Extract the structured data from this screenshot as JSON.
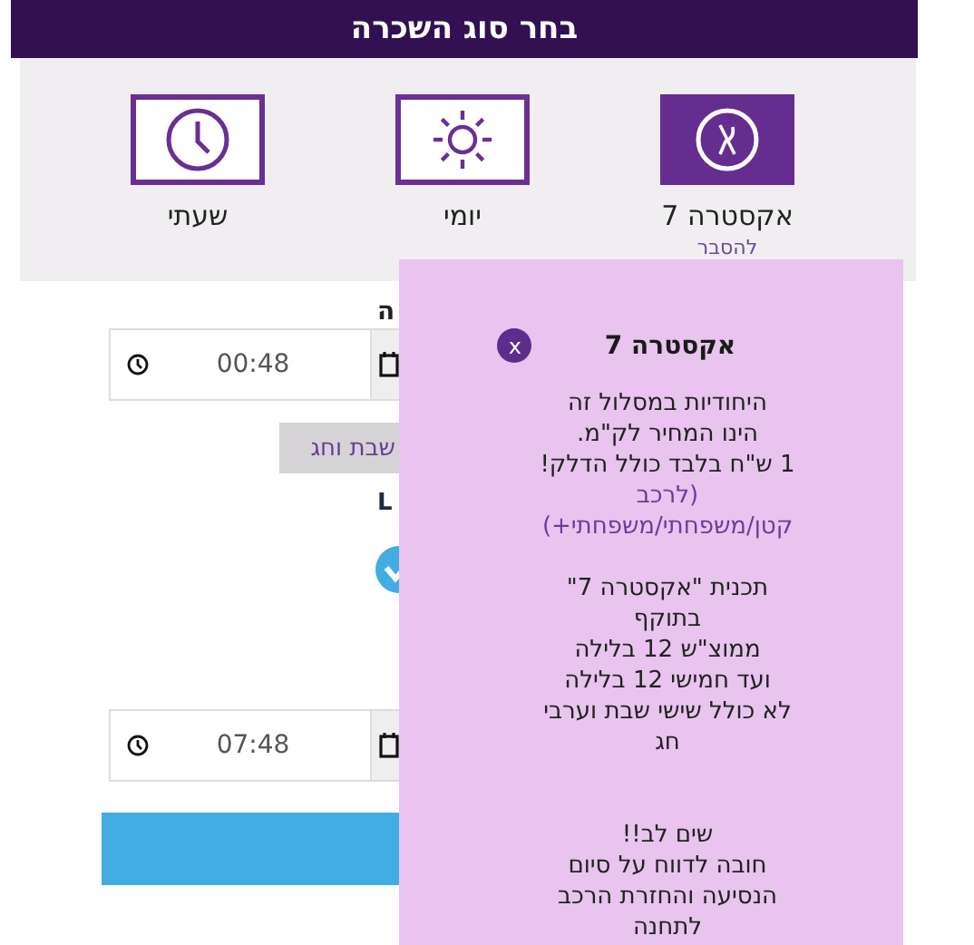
{
  "header": {
    "title": "בחר סוג השכרה"
  },
  "rental_types": [
    {
      "kind": "extra",
      "label": "אקסטרה 7",
      "selected": true,
      "link": "להסבר"
    },
    {
      "kind": "daily",
      "label": "יומי",
      "selected": false
    },
    {
      "kind": "hourly",
      "label": "שעתי",
      "selected": false
    }
  ],
  "form": {
    "start_label": "ה",
    "start_time": "00:48",
    "holiday_button": "שבת וחג",
    "status_text": "L",
    "end_time": "07:48"
  },
  "popup": {
    "title": "אקסטרה 7",
    "close": "x",
    "blocks": [
      {
        "kind": "text",
        "lines": [
          "היחודיות במסלול זה",
          "הינו המחיר לק\"מ.",
          "1 ש\"ח בלבד כולל הדלק!"
        ]
      },
      {
        "kind": "note",
        "lines": [
          "(לרכב",
          "קטן/משפחתי/משפחתי+)"
        ]
      },
      {
        "kind": "gap"
      },
      {
        "kind": "text",
        "lines": [
          "תכנית \"אקסטרה 7\"",
          "בתוקף",
          "ממוצ\"ש 12 בלילה",
          "ועד חמישי 12 בלילה",
          "לא כולל שישי שבת וערבי",
          "חג"
        ]
      },
      {
        "kind": "gap"
      },
      {
        "kind": "gap"
      },
      {
        "kind": "text",
        "lines": [
          "שים לב!!",
          "חובה לדווח על סיום",
          "הנסיעה והחזרת הרכב",
          "לתחנה"
        ]
      }
    ]
  }
}
